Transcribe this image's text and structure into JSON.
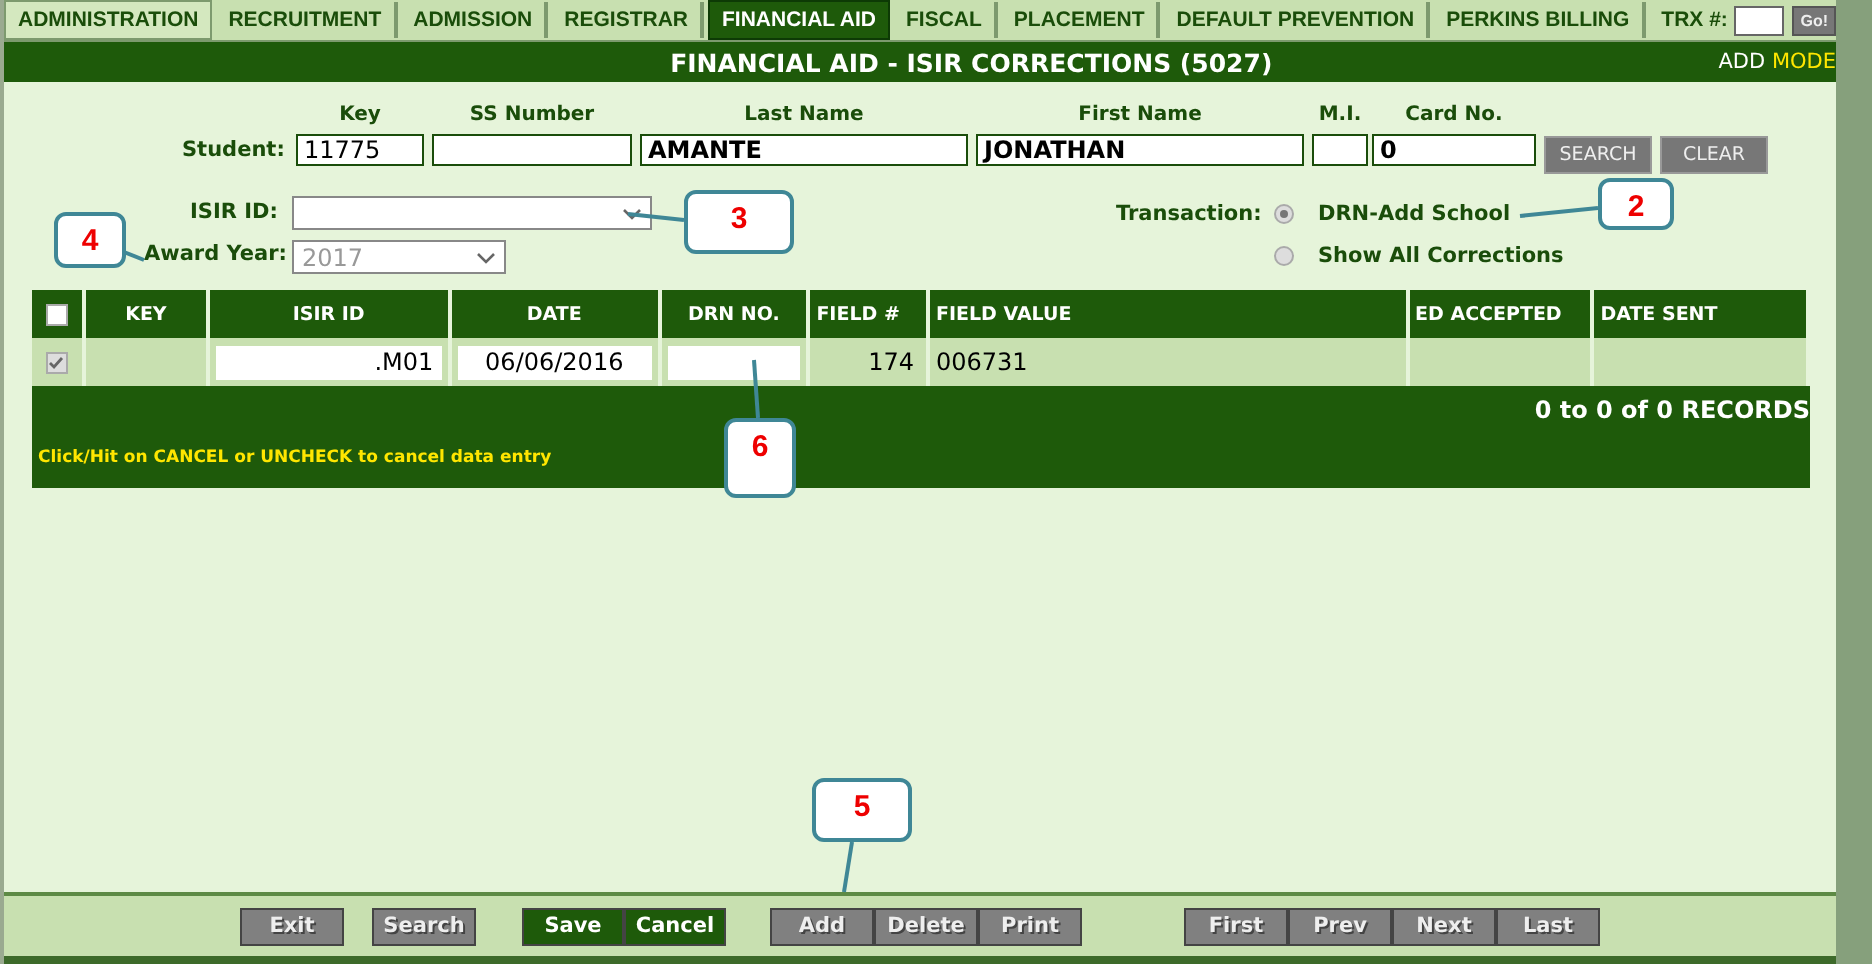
{
  "nav_tabs": [
    {
      "label": "ADMINISTRATION",
      "selected": false
    },
    {
      "label": "RECRUITMENT",
      "selected": false
    },
    {
      "label": "ADMISSION",
      "selected": false
    },
    {
      "label": "REGISTRAR",
      "selected": false
    },
    {
      "label": "FINANCIAL AID",
      "selected": true
    },
    {
      "label": "FISCAL",
      "selected": false
    },
    {
      "label": "PLACEMENT",
      "selected": false
    },
    {
      "label": "DEFAULT PREVENTION",
      "selected": false
    },
    {
      "label": "PERKINS BILLING",
      "selected": false
    }
  ],
  "trx": {
    "label": "TRX #:",
    "button": "Go!"
  },
  "title_bar": {
    "title": "FINANCIAL AID - ISIR CORRECTIONS (5027)",
    "mode_label": "ADD",
    "mode_cut": "MODE"
  },
  "student": {
    "label": "Student:",
    "fields": [
      {
        "heading": "Key",
        "value": "11775"
      },
      {
        "heading": "SS Number"
      },
      {
        "heading": "Last Name",
        "value": "AMANTE"
      },
      {
        "heading": "First Name",
        "value": "JONATHAN"
      },
      {
        "heading": "M.I."
      },
      {
        "heading": "Card No.",
        "value": "0"
      }
    ],
    "buttons": [
      "SEARCH",
      "CLEAR"
    ]
  },
  "isir_id": {
    "label": "ISIR ID:"
  },
  "award_year": {
    "label": "Award Year:",
    "value": "2017"
  },
  "transaction": {
    "label": "Transaction:",
    "options": [
      {
        "label": "DRN-Add School",
        "selected": true
      },
      {
        "label": "Show All Corrections",
        "selected": false
      }
    ]
  },
  "table": {
    "columns": [
      "KEY",
      "ISIR ID",
      "DATE",
      "DRN NO.",
      "FIELD #",
      "FIELD VALUE",
      "ED ACCEPTED",
      "DATE SENT"
    ],
    "header_checked": false,
    "rows": [
      {
        "checked": true,
        "isir_id": ".M01",
        "date": "06/06/2016",
        "field_no": "174",
        "field_value": "006731"
      }
    ],
    "records": "0 to 0 of 0 RECORDS",
    "hint": "Click/Hit on CANCEL or UNCHECK to cancel data entry"
  },
  "toolbar": [
    {
      "label": "Exit",
      "kind": "plain"
    },
    {
      "label": "Search",
      "kind": "plain"
    },
    {
      "label": "Save",
      "kind": "primary"
    },
    {
      "label": "Cancel",
      "kind": "primary"
    },
    {
      "label": "Add",
      "kind": "plain"
    },
    {
      "label": "Delete",
      "kind": "plain"
    },
    {
      "label": "Print",
      "kind": "plain"
    },
    {
      "label": "First",
      "kind": "plain"
    },
    {
      "label": "Prev",
      "kind": "plain"
    },
    {
      "label": "Next",
      "kind": "plain"
    },
    {
      "label": "Last",
      "kind": "plain"
    }
  ],
  "callouts": [
    {
      "number": "3"
    },
    {
      "number": "2"
    },
    {
      "number": "4"
    },
    {
      "number": "6"
    },
    {
      "number": "5"
    }
  ]
}
